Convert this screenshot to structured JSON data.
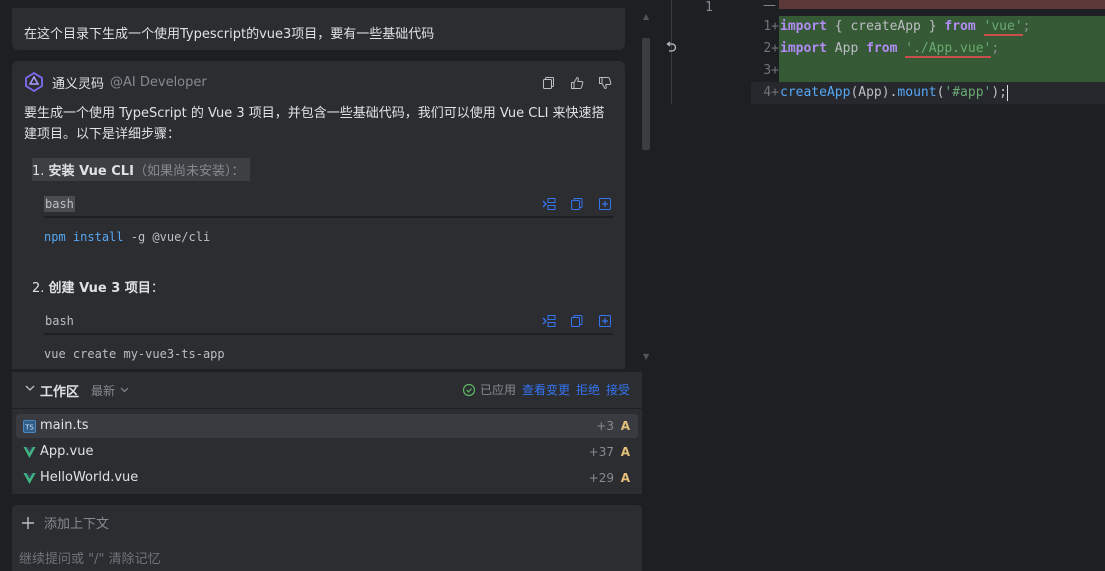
{
  "chat": {
    "user_message": "在这个目录下生成一个使用Typescript的vue3项目，要有一些基础代码",
    "ai": {
      "name": "通义灵码",
      "role": "@AI Developer",
      "intro": "要生成一个使用 TypeScript 的 Vue 3 项目，并包含一些基础代码，我们可以使用 Vue CLI 来快速搭建项目。以下是详细步骤：",
      "steps": [
        {
          "number": "1.",
          "title": "安装 Vue CLI",
          "hint": "（如果尚未安装）：",
          "code_lang": "bash",
          "code_cmd": "npm",
          "code_sub": "install",
          "code_rest": " -g @vue/cli"
        },
        {
          "number": "2.",
          "title": "创建 Vue 3 项目",
          "hint": "：",
          "code_lang": "bash",
          "code_text": "vue create my-vue3-ts-app"
        }
      ]
    }
  },
  "workspace": {
    "title": "工作区",
    "sort_label": "最新",
    "status": "已应用",
    "view_changes": "查看变更",
    "reject": "拒绝",
    "accept": "接受",
    "files": [
      {
        "name": "main.ts",
        "icon": "typescript-file-icon",
        "count": "+3",
        "flag": "A"
      },
      {
        "name": "App.vue",
        "icon": "vue-file-icon",
        "count": "+37",
        "flag": "A"
      },
      {
        "name": "HelloWorld.vue",
        "icon": "vue-file-icon",
        "count": "+29",
        "flag": "A"
      }
    ]
  },
  "input": {
    "add_context": "添加上下文",
    "placeholder": "继续提问或 \"/\" 清除记忆"
  },
  "editor": {
    "original_line_number": "1",
    "original_marker": "—",
    "lines": [
      {
        "num": "1+",
        "t1": "import",
        "t2": " { createApp } ",
        "t3": "from",
        "t4": " ",
        "t5": "'vue'",
        "t6": ";"
      },
      {
        "num": "2+",
        "t1": "import",
        "t2": " App ",
        "t3": "from",
        "t4": " ",
        "t5": "'./App.vue'",
        "t6": ";"
      },
      {
        "num": "3+"
      },
      {
        "num": "4+",
        "t1": "createApp",
        "t2": "(App).",
        "t3": "mount",
        "t4": "(",
        "t5": "'#app'",
        "t6": ");"
      }
    ]
  },
  "colors": {
    "accent": "#3574f0",
    "added_bg": "#355a35",
    "deleted_bg": "#5c3838",
    "panel": "#2b2d30",
    "background": "#1e1f22"
  }
}
